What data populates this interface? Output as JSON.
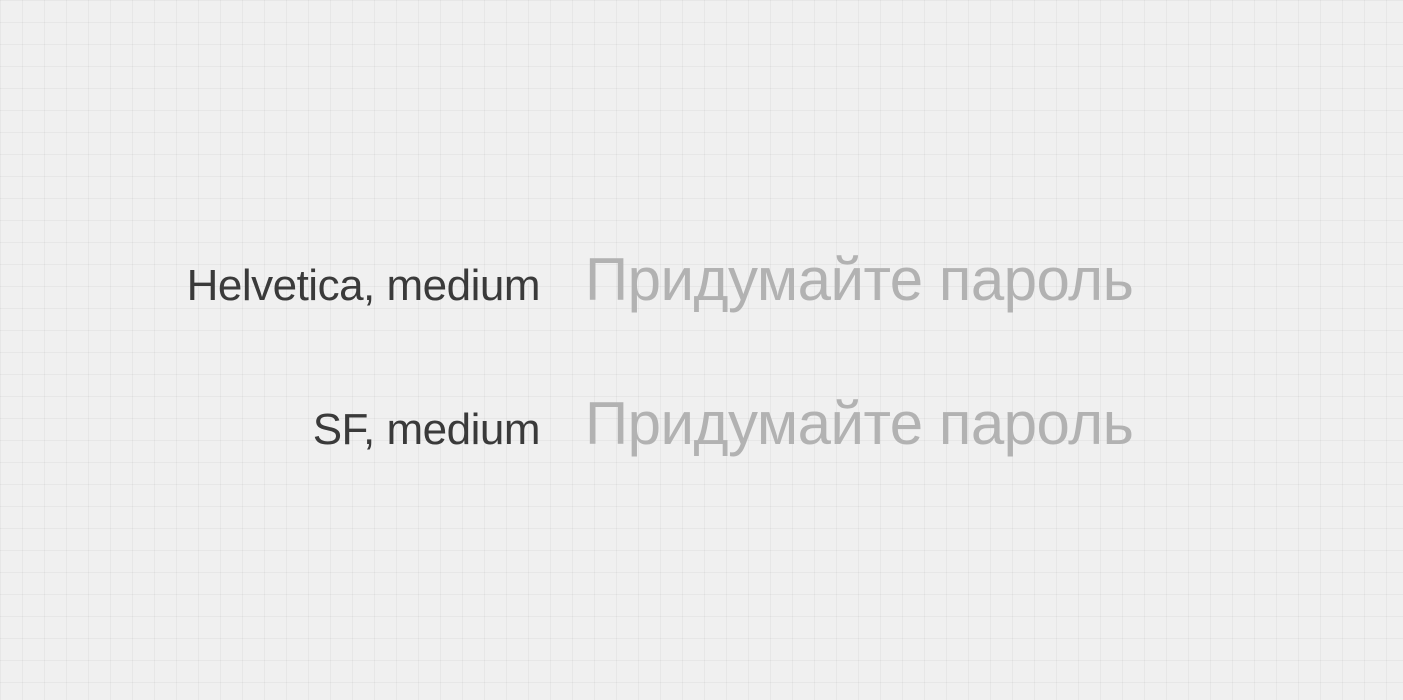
{
  "rows": [
    {
      "label": "Helvetica, medium",
      "sample": "Придумайте пароль"
    },
    {
      "label": "SF, medium",
      "sample": "Придумайте пароль"
    }
  ]
}
